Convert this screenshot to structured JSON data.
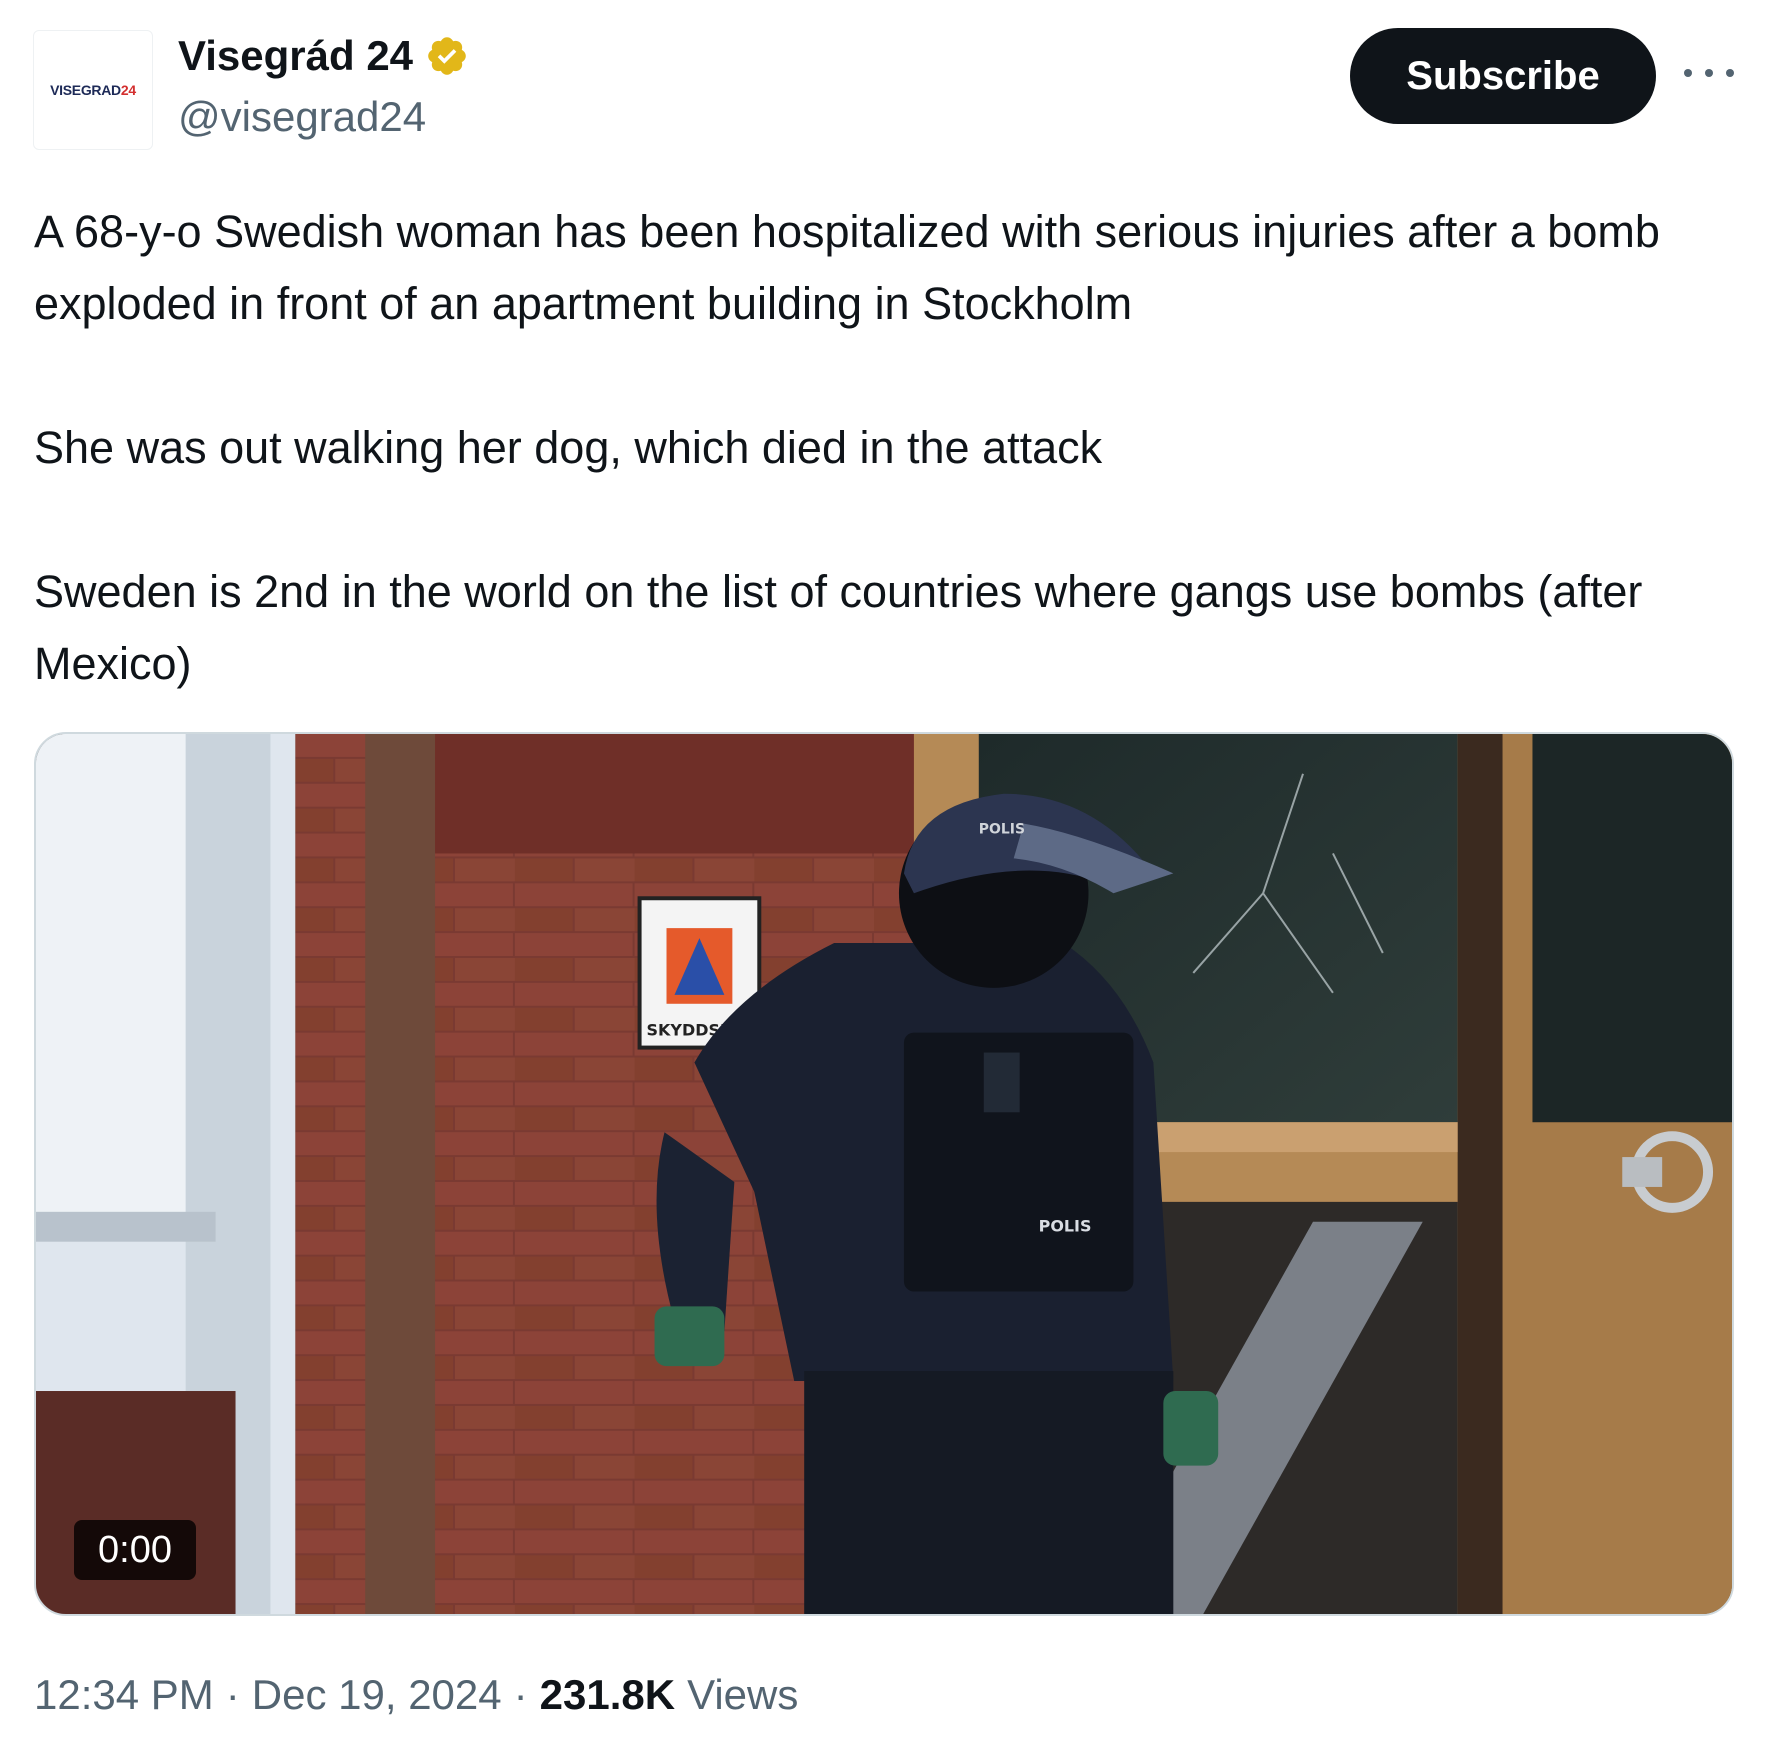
{
  "author": {
    "avatar_text": "VISEGRAD",
    "avatar_text_num": "24",
    "display_name": "Visegrád 24",
    "handle": "@visegrad24",
    "verified_icon": "verified-badge-gold"
  },
  "actions": {
    "subscribe_label": "Subscribe",
    "more_icon": "more-horizontal-icon"
  },
  "tweet": {
    "paragraphs": [
      "A 68-y-o Swedish woman has been hospitalized with serious injuries after a bomb exploded in front of an apartment building in Stockholm",
      "She was out walking her dog, which died in the attack",
      "Sweden is 2nd in the world on the list of countries where gangs use bombs (after Mexico)"
    ]
  },
  "media": {
    "type": "video",
    "duration": "0:00",
    "sign_text": "SKYDDSRU",
    "vest_text": "POLIS",
    "cap_text": "POLIS"
  },
  "footer": {
    "time": "12:34 PM",
    "separator": "·",
    "date": "Dec 19, 2024",
    "views_count": "231.8K",
    "views_label": "Views"
  },
  "colors": {
    "text_primary": "#0f1419",
    "text_secondary": "#536471",
    "button_bg": "#0f1419",
    "verified_gold": "#e2b719"
  }
}
